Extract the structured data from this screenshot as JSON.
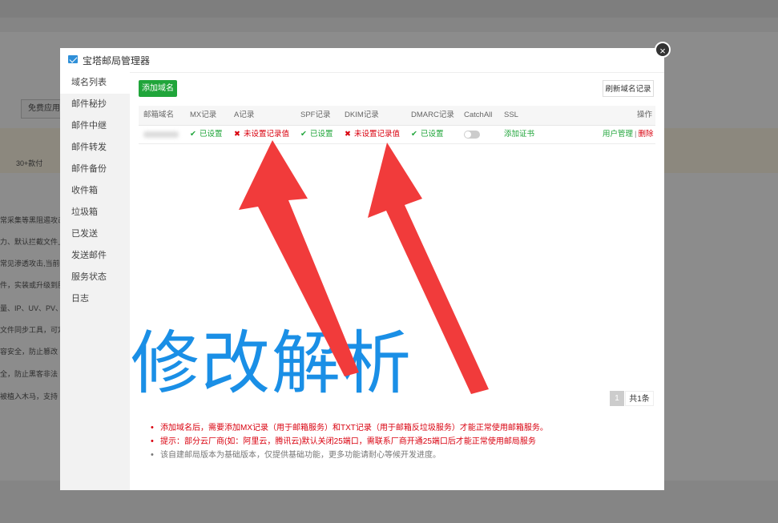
{
  "modal": {
    "title": "宝塔邮局管理器",
    "close_symbol": "×"
  },
  "sidebar": {
    "items": [
      {
        "label": "域名列表",
        "active": true
      },
      {
        "label": "邮件秘抄"
      },
      {
        "label": "邮件中继"
      },
      {
        "label": "邮件转发"
      },
      {
        "label": "邮件备份"
      },
      {
        "label": "收件箱"
      },
      {
        "label": "垃圾箱"
      },
      {
        "label": "已发送"
      },
      {
        "label": "发送邮件"
      },
      {
        "label": "服务状态"
      },
      {
        "label": "日志"
      }
    ]
  },
  "toolbar": {
    "add_label": "添加域名",
    "refresh_label": "刷新域名记录"
  },
  "table": {
    "headers": {
      "domain": "邮箱域名",
      "mx": "MX记录",
      "a": "A记录",
      "spf": "SPF记录",
      "dkim": "DKIM记录",
      "dmarc": "DMARC记录",
      "catchall": "CatchAll",
      "ssl": "SSL",
      "ops": "操作"
    },
    "row": {
      "mx": "已设置",
      "a": "未设置记录值",
      "spf": "已设置",
      "dkim": "未设置记录值",
      "dmarc": "已设置",
      "catchall_on": false,
      "ssl": "添加证书",
      "op_manage": "用户管理",
      "op_sep": "|",
      "op_delete": "删除"
    },
    "status_ok_mark": "✔",
    "status_bad_mark": "✖"
  },
  "pager": {
    "current": "1",
    "total": "共1条"
  },
  "tips": [
    "添加域名后，需要添加MX记录（用于邮箱服务）和TXT记录（用于邮箱反垃圾服务）才能正常使用邮箱服务。",
    "提示：部分云厂商(如：阿里云，腾讯云)默认关闭25端口，需联系厂商开通25端口后才能正常使用邮局服务",
    "该自建邮局版本为基础版本，仅提供基础功能，更多功能请耐心等候开发进度。"
  ],
  "annotation": {
    "text": "修改解析",
    "color": "#1a8fe6",
    "arrow_color": "#f13b3b"
  },
  "colors": {
    "accent_green": "#20a53a",
    "error_red": "#d9000e"
  },
  "background_page": {
    "buttons": [
      "免费应用"
    ],
    "lines": [
      "30+款付",
      "常采集等黑阻遏攻击",
      "力、默认拦截文件上",
      "常见渗透攻击,当前仅",
      "件，实装或升级到服",
      "量、IP、UV、PV、",
      "文件同步工具，可定",
      "容安全，防止篡改",
      "全，防止黑客非法",
      "被植入木马，支持"
    ]
  }
}
